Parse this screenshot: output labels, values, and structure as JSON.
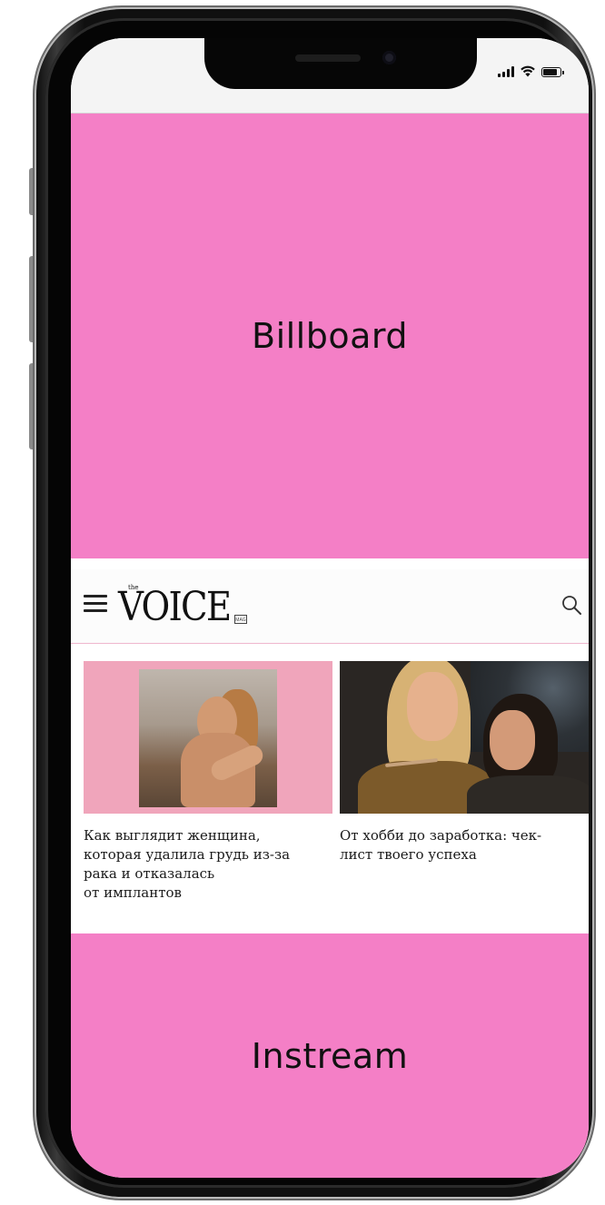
{
  "billboard": {
    "label": "Billboard",
    "color": "#f47fc6"
  },
  "instream": {
    "label": "Instream",
    "color": "#f47fc6"
  },
  "site": {
    "logo": {
      "the": "the",
      "text": "VOICE",
      "mag": "MAG"
    },
    "icons": {
      "menu": "hamburger-menu-icon",
      "search": "search-icon"
    },
    "articles": [
      {
        "title_lines": [
          "Как выглядит женщина,",
          "которая удалила грудь из-за",
          "рака и отказалась",
          "от имплантов"
        ]
      },
      {
        "title_lines": [
          "От хобби до заработка: чек-",
          "лист твоего успеха"
        ]
      }
    ]
  },
  "status_bar": {
    "icons": [
      "cellular-signal-icon",
      "wifi-icon",
      "battery-icon"
    ]
  }
}
